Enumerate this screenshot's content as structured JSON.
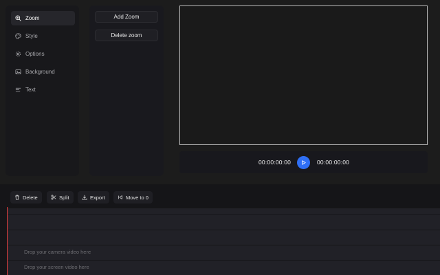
{
  "sidebar": {
    "items": [
      {
        "label": "Zoom",
        "icon": "zoom-in-icon",
        "active": true
      },
      {
        "label": "Style",
        "icon": "palette-icon",
        "active": false
      },
      {
        "label": "Options",
        "icon": "gear-icon",
        "active": false
      },
      {
        "label": "Background",
        "icon": "image-icon",
        "active": false
      },
      {
        "label": "Text",
        "icon": "text-align-icon",
        "active": false
      }
    ]
  },
  "zoom_panel": {
    "add_label": "Add Zoom",
    "delete_label": "Delete zoom"
  },
  "player": {
    "current_time": "00:00:00:00",
    "total_time": "00:00:00:00",
    "play_icon": "play-icon",
    "accent": "#2f6ff5"
  },
  "toolbar": {
    "delete_label": "Delete",
    "split_label": "Split",
    "export_label": "Export",
    "move_label": "Move to 0"
  },
  "tracks": {
    "camera_drop": "Drop your camera video here",
    "screen_drop": "Drop your screen video here"
  },
  "colors": {
    "playhead": "#e53e3e",
    "background": "#1c1c1c"
  }
}
